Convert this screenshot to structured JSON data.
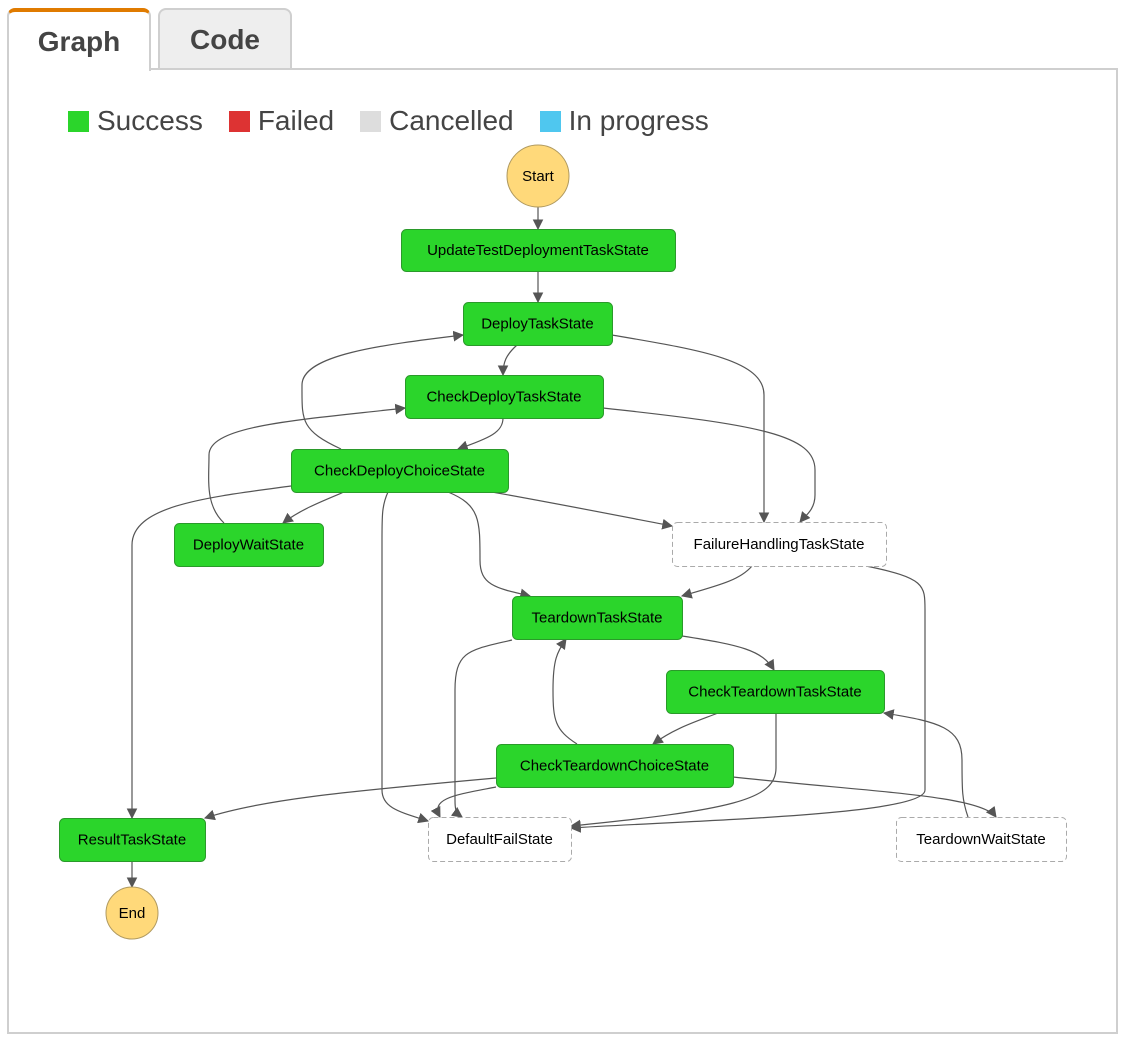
{
  "tabs": [
    {
      "label": "Graph",
      "active": true
    },
    {
      "label": "Code",
      "active": false
    }
  ],
  "legend": [
    {
      "label": "Success",
      "color": "#2bd52b"
    },
    {
      "label": "Failed",
      "color": "#dd3333"
    },
    {
      "label": "Cancelled",
      "color": "#dddddd"
    },
    {
      "label": "In progress",
      "color": "#4fc7ef"
    }
  ],
  "colors": {
    "success": "#2bd52b",
    "success_border": "#2a9a2a",
    "terminal": "#ffd97a",
    "terminal_border": "#b09a60",
    "not_run_border": "#aaaaaa",
    "edge": "#555555"
  },
  "graph": {
    "nodes": [
      {
        "id": "start",
        "label": "Start",
        "kind": "terminal"
      },
      {
        "id": "update",
        "label": "UpdateTestDeploymentTaskState",
        "status": "success"
      },
      {
        "id": "deploy",
        "label": "DeployTaskState",
        "status": "success"
      },
      {
        "id": "checkDeployTask",
        "label": "CheckDeployTaskState",
        "status": "success"
      },
      {
        "id": "checkDeployChoice",
        "label": "CheckDeployChoiceState",
        "status": "success"
      },
      {
        "id": "deployWait",
        "label": "DeployWaitState",
        "status": "success"
      },
      {
        "id": "failureHandling",
        "label": "FailureHandlingTaskState",
        "status": "not-run"
      },
      {
        "id": "teardown",
        "label": "TeardownTaskState",
        "status": "success"
      },
      {
        "id": "checkTeardownTask",
        "label": "CheckTeardownTaskState",
        "status": "success"
      },
      {
        "id": "checkTeardownChoice",
        "label": "CheckTeardownChoiceState",
        "status": "success"
      },
      {
        "id": "result",
        "label": "ResultTaskState",
        "status": "success"
      },
      {
        "id": "defaultFail",
        "label": "DefaultFailState",
        "status": "not-run"
      },
      {
        "id": "teardownWait",
        "label": "TeardownWaitState",
        "status": "not-run"
      },
      {
        "id": "end",
        "label": "End",
        "kind": "terminal"
      }
    ],
    "edges": [
      {
        "from": "start",
        "to": "update"
      },
      {
        "from": "update",
        "to": "deploy"
      },
      {
        "from": "deploy",
        "to": "checkDeployTask"
      },
      {
        "from": "deploy",
        "to": "failureHandling"
      },
      {
        "from": "checkDeployTask",
        "to": "checkDeployChoice"
      },
      {
        "from": "checkDeployTask",
        "to": "failureHandling"
      },
      {
        "from": "checkDeployChoice",
        "to": "deploy"
      },
      {
        "from": "checkDeployChoice",
        "to": "deployWait"
      },
      {
        "from": "checkDeployChoice",
        "to": "result"
      },
      {
        "from": "checkDeployChoice",
        "to": "defaultFail"
      },
      {
        "from": "checkDeployChoice",
        "to": "teardown"
      },
      {
        "from": "checkDeployChoice",
        "to": "failureHandling"
      },
      {
        "from": "deployWait",
        "to": "checkDeployTask"
      },
      {
        "from": "failureHandling",
        "to": "teardown"
      },
      {
        "from": "failureHandling",
        "to": "defaultFail"
      },
      {
        "from": "teardown",
        "to": "checkTeardownTask"
      },
      {
        "from": "teardown",
        "to": "defaultFail"
      },
      {
        "from": "checkTeardownTask",
        "to": "checkTeardownChoice"
      },
      {
        "from": "checkTeardownTask",
        "to": "defaultFail"
      },
      {
        "from": "checkTeardownChoice",
        "to": "teardown"
      },
      {
        "from": "checkTeardownChoice",
        "to": "result"
      },
      {
        "from": "checkTeardownChoice",
        "to": "defaultFail"
      },
      {
        "from": "checkTeardownChoice",
        "to": "teardownWait"
      },
      {
        "from": "teardownWait",
        "to": "checkTeardownTask"
      },
      {
        "from": "result",
        "to": "end"
      }
    ]
  }
}
